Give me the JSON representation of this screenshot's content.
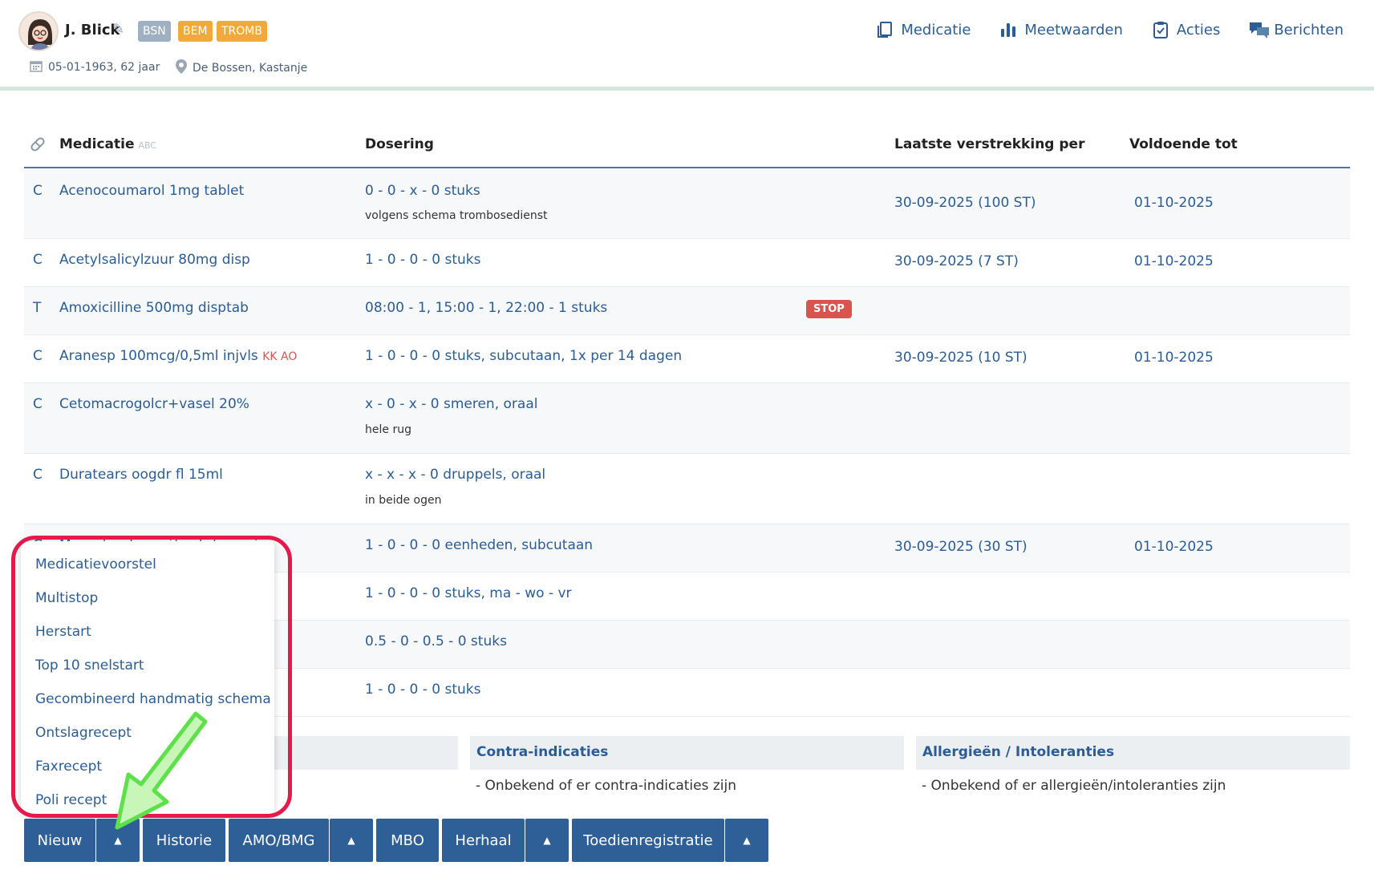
{
  "header": {
    "patient_name": "J. Blick",
    "badges": [
      "BSN",
      "BEM",
      "TROMB"
    ],
    "dob": "05-01-1963, 62 jaar",
    "location": "De Bossen, Kastanje",
    "nav": [
      {
        "label": "Medicatie",
        "icon": "copy-icon"
      },
      {
        "label": "Meetwaarden",
        "icon": "bar-chart-icon"
      },
      {
        "label": "Acties",
        "icon": "clipboard-check-icon"
      },
      {
        "label": "Berichten",
        "icon": "chat-bubbles-icon"
      }
    ]
  },
  "table": {
    "headers": {
      "medicatie": "Medicatie",
      "abc": "ABC",
      "dosering": "Dosering",
      "laatste": "Laatste verstrekking per",
      "voldoende": "Voldoende tot"
    },
    "rows": [
      {
        "type": "C",
        "name": "Acenocoumarol 1mg tablet",
        "dose": "0 - 0 - x - 0 stuks",
        "note": "volgens schema trombosedienst",
        "last": "30-09-2025 (100 ST)",
        "tot": "01-10-2025"
      },
      {
        "type": "C",
        "name": "Acetylsalicylzuur 80mg disp",
        "dose": "1 - 0 - 0 - 0 stuks",
        "note": "",
        "last": "30-09-2025 (7 ST)",
        "tot": "01-10-2025"
      },
      {
        "type": "T",
        "name": "Amoxicilline 500mg disptab",
        "dose": "08:00 - 1, 15:00 - 1, 22:00 - 1 stuks",
        "note": "",
        "last": "",
        "tot": "",
        "stop": "STOP"
      },
      {
        "type": "C",
        "name": "Aranesp 100mcg/0,5ml injvls",
        "flag": "KK AO",
        "dose": "1 - 0 - 0 - 0 stuks, subcutaan, 1x per 14 dagen",
        "note": "",
        "last": "30-09-2025 (10 ST)",
        "tot": "01-10-2025"
      },
      {
        "type": "C",
        "name": "Cetomacrogolcr+vasel 20%",
        "dose": "x - 0 - x - 0 smeren, oraal",
        "note": "hele rug",
        "last": "",
        "tot": ""
      },
      {
        "type": "C",
        "name": "Duratears oogdr fl 15ml",
        "dose": "x - x - x - 0 druppels, oraal",
        "note": "in beide ogen",
        "last": "",
        "tot": ""
      },
      {
        "type": "C",
        "name": "Macro/zout movi/mola/gen gi",
        "dose": "1 - 0 - 0 - 0 eenheden, subcutaan",
        "note": "",
        "last": "30-09-2025 (30 ST)",
        "tot": "01-10-2025"
      },
      {
        "type": "",
        "name": "",
        "dose": "1 - 0 - 0 - 0 stuks, ma - wo - vr",
        "note": "",
        "last": "",
        "tot": ""
      },
      {
        "type": "",
        "name": "",
        "dose": "0.5 - 0 - 0.5 - 0 stuks",
        "note": "",
        "last": "",
        "tot": ""
      },
      {
        "type": "",
        "name": "",
        "dose": "1 - 0 - 0 - 0 stuks",
        "note": "",
        "last": "",
        "tot": ""
      }
    ]
  },
  "panels": {
    "contra_title": "Contra-indicaties",
    "contra_text": "- Onbekend of er contra-indicaties zijn",
    "allergy_title": "Allergieën / Intoleranties",
    "allergy_text": "- Onbekend of er allergieën/intoleranties zijn"
  },
  "dropdown": {
    "items": [
      "Medicatievoorstel",
      "Multistop",
      "Herstart",
      "Top 10 snelstart",
      "Gecombineerd handmatig schema",
      "Ontslagrecept",
      "Faxrecept",
      "Poli recept"
    ]
  },
  "buttons": {
    "nieuw": "Nieuw",
    "historie": "Historie",
    "amo": "AMO/BMG",
    "mbo": "MBO",
    "herhaal": "Herhaal",
    "toedien": "Toedienregistratie",
    "caret": "▲"
  },
  "colors": {
    "primary": "#2e5f96",
    "link": "#2b5d94",
    "stop": "#d9534f",
    "badge_grey": "#9fb0c3",
    "badge_orange": "#f0a93a",
    "highlight": "#e6194b",
    "arrow": "#5ee04a"
  }
}
